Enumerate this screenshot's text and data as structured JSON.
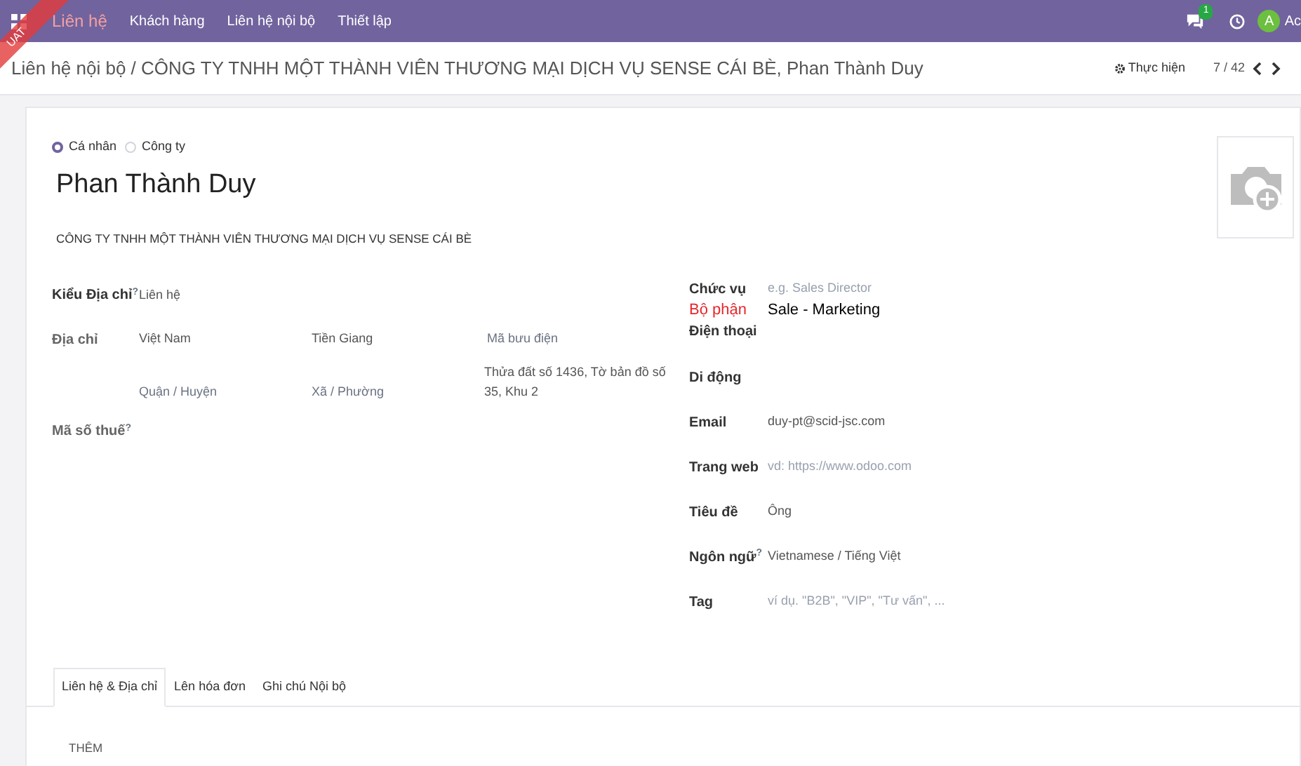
{
  "navbar": {
    "app": "Liên hệ",
    "menu": [
      "Khách hàng",
      "Liên hệ nội bộ",
      "Thiết lập"
    ],
    "message_count": "1",
    "avatar_letter": "A",
    "user_name": "Ac"
  },
  "ribbon": {
    "text": "UAT"
  },
  "breadcrumb": {
    "path": "Liên hệ nội bộ",
    "separator": "/",
    "current": "CÔNG TY TNHH MỘT THÀNH VIÊN THƯƠNG MẠI DỊCH VỤ SENSE CÁI BÈ, Phan Thành Duy"
  },
  "actions": {
    "label": "Thực hiện",
    "pager": "7 / 42"
  },
  "type_options": [
    {
      "label": "Cá nhân",
      "selected": true
    },
    {
      "label": "Công ty",
      "selected": false
    }
  ],
  "name": "Phan Thành Duy",
  "company": "CÔNG TY TNHH MỘT THÀNH VIÊN THƯƠNG MẠI DỊCH VỤ SENSE CÁI BÈ",
  "address_type": {
    "label": "Kiểu Địa chỉ",
    "help": "?",
    "value": "Liên hệ"
  },
  "address": {
    "label": "Địa chỉ",
    "country": "Việt Nam",
    "state": "Tiền Giang",
    "zip_placeholder": "Mã bưu điện",
    "street": "Thửa đất số 1436, Tờ bản đồ số 35, Khu 2",
    "district_placeholder": "Quận / Huyện",
    "ward_placeholder": "Xã / Phường"
  },
  "tax_id": {
    "label": "Mã số thuế",
    "help": "?"
  },
  "right_fields": [
    {
      "label": "Chức vụ",
      "kind": "placeholder",
      "placeholder": "e.g. Sales Director"
    },
    {
      "label": "Bộ phận",
      "kind": "highlight",
      "value": "Sale - Marketing"
    },
    {
      "label": "Điện thoại",
      "kind": "empty"
    },
    {
      "label": "Di động",
      "kind": "empty"
    },
    {
      "label": "Email",
      "kind": "value",
      "value": "duy-pt@scid-jsc.com"
    },
    {
      "label": "Trang web",
      "kind": "placeholder",
      "placeholder": "vd: https://www.odoo.com"
    },
    {
      "label": "Tiêu đề",
      "kind": "value",
      "value": "Ông"
    },
    {
      "label": "Ngôn ngữ",
      "help": "?",
      "kind": "value",
      "value": "Vietnamese / Tiếng Việt"
    },
    {
      "label": "Tag",
      "kind": "placeholder",
      "placeholder": "ví dụ. \"B2B\", \"VIP\", \"Tư vấn\", ..."
    }
  ],
  "tabs": [
    {
      "label": "Liên hệ & Địa chỉ",
      "selected": true
    },
    {
      "label": "Lên hóa đơn",
      "selected": false
    },
    {
      "label": "Ghi chú Nội bộ",
      "selected": false
    }
  ],
  "add_button": "THÊM"
}
